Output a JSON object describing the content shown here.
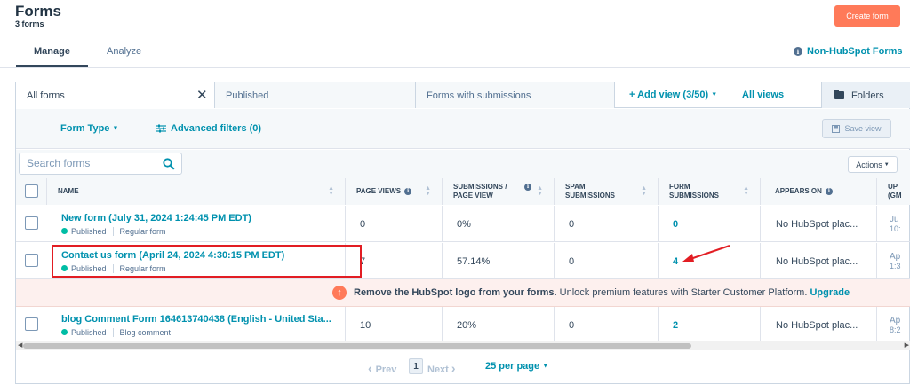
{
  "header": {
    "title": "Forms",
    "count": "3 forms",
    "create_button": "Create form"
  },
  "tabs": {
    "manage": "Manage",
    "analyze": "Analyze",
    "non_hubspot": "Non-HubSpot Forms"
  },
  "view_tabs": {
    "all": "All forms",
    "published": "Published",
    "with_submissions": "Forms with submissions",
    "add_view": "Add view (3/50)",
    "all_views": "All views",
    "folders": "Folders"
  },
  "filters": {
    "form_type": "Form Type",
    "advanced": "Advanced filters (0)",
    "save_view": "Save view"
  },
  "search": {
    "placeholder": "Search forms",
    "value": ""
  },
  "actions_label": "Actions",
  "columns": {
    "name": "NAME",
    "page_views": "PAGE VIEWS",
    "submissions_per_view_1": "SUBMISSIONS /",
    "submissions_per_view_2": "PAGE VIEW",
    "spam_1": "SPAM",
    "spam_2": "SUBMISSIONS",
    "form_sub_1": "FORM",
    "form_sub_2": "SUBMISSIONS",
    "appears_on": "APPEARS ON",
    "updated_1": "UP",
    "updated_2": "(GM"
  },
  "rows": [
    {
      "name": "New form (July 31, 2024 1:24:45 PM EDT)",
      "status": "Published",
      "type": "Regular form",
      "page_views": "0",
      "rate": "0%",
      "spam": "0",
      "submissions": "0",
      "appears_on": "No HubSpot plac...",
      "updated_1": "Ju",
      "updated_2": "10:"
    },
    {
      "name": "Contact us form (April 24, 2024 4:30:15 PM EDT)",
      "status": "Published",
      "type": "Regular form",
      "page_views": "7",
      "rate": "57.14%",
      "spam": "0",
      "submissions": "4",
      "appears_on": "No HubSpot plac...",
      "updated_1": "Ap",
      "updated_2": "1:3"
    },
    {
      "name": "blog Comment Form 164613740438 (English - United Sta...",
      "status": "Published",
      "type": "Blog comment",
      "page_views": "10",
      "rate": "20%",
      "spam": "0",
      "submissions": "2",
      "appears_on": "No HubSpot plac...",
      "updated_1": "Ap",
      "updated_2": "8:2"
    }
  ],
  "banner": {
    "bold": "Remove the HubSpot logo from your forms.",
    "text": "Unlock premium features with Starter Customer Platform.",
    "link": "Upgrade"
  },
  "pagination": {
    "prev": "Prev",
    "page": "1",
    "next": "Next",
    "per_page": "25 per page"
  },
  "colors": {
    "accent": "#0091ae",
    "primary_button": "#ff7a59",
    "published_dot": "#00bda5",
    "highlight_red": "#e21d23"
  }
}
